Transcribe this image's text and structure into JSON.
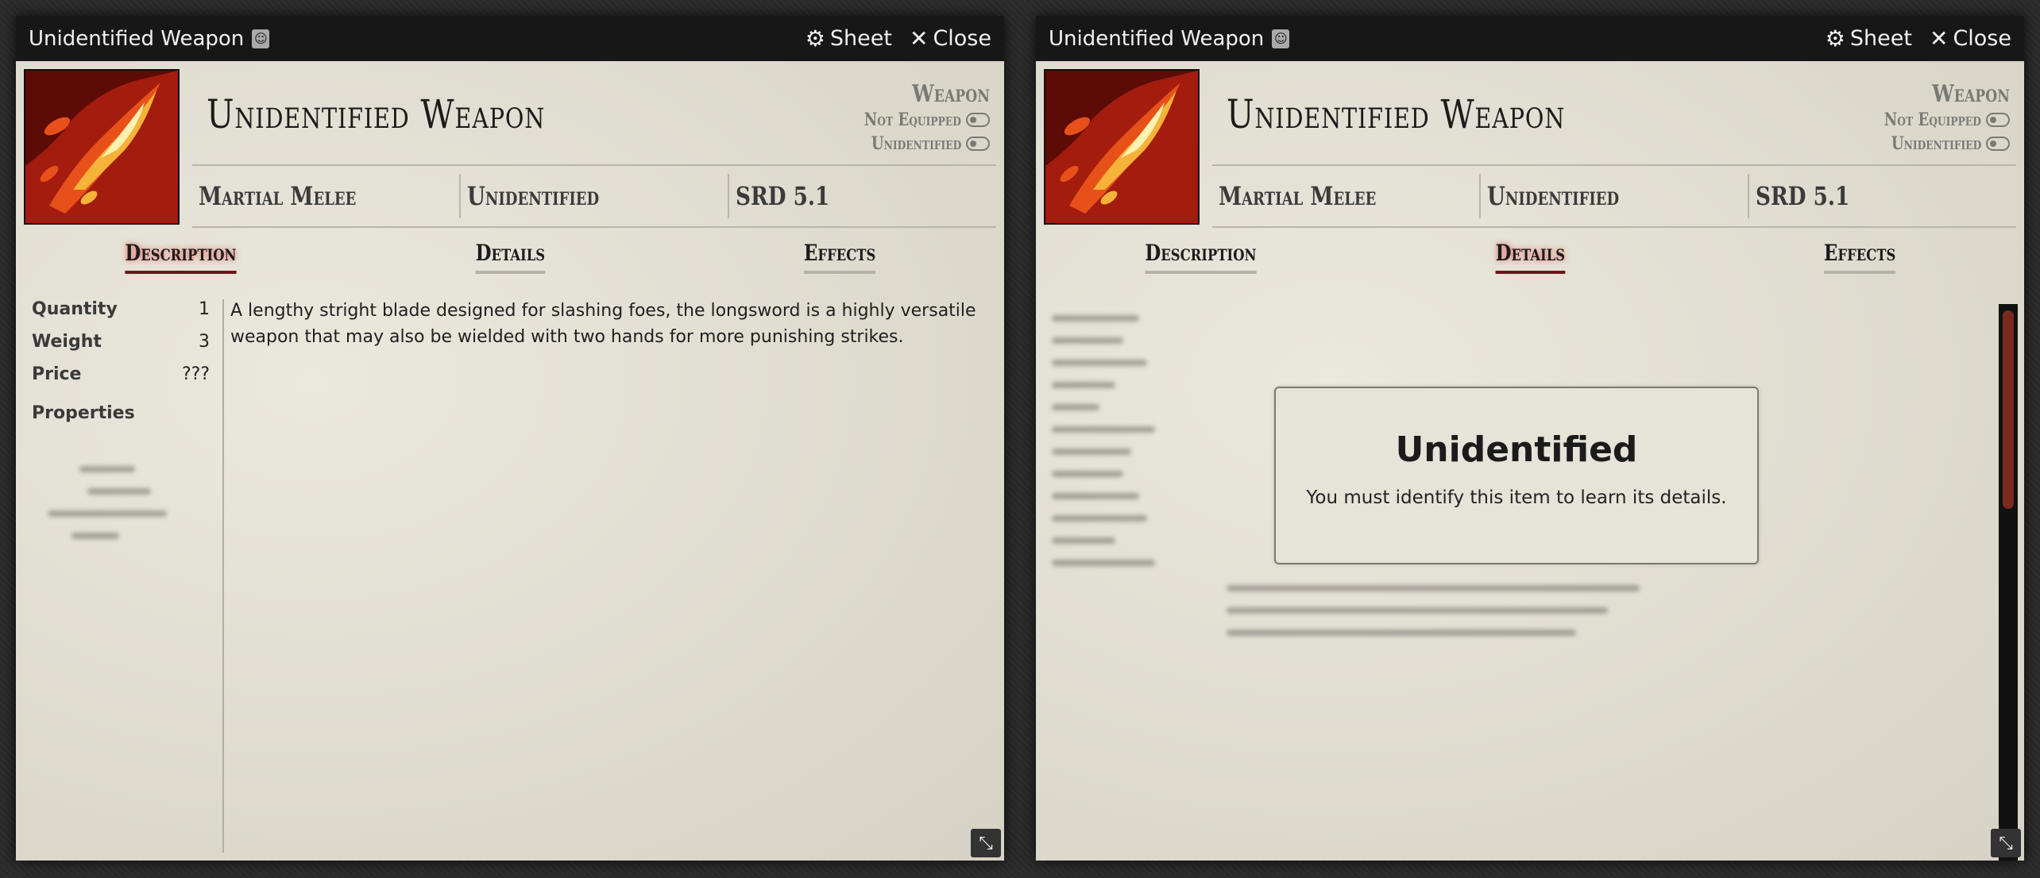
{
  "colors": {
    "accent": "#6e1515",
    "titlebar": "#171717",
    "parchment": "#e6e3d8"
  },
  "windows": [
    {
      "title": "Unidentified Weapon",
      "title_icon": "scroll-document-icon",
      "sheet_label": "Sheet",
      "close_label": "Close",
      "item_name": "Unidentified Weapon",
      "item_type": "Weapon",
      "equipped_label": "Not Equipped",
      "identified_label": "Unidentified",
      "summary": [
        "Martial Melee",
        "Unidentified",
        "SRD 5.1"
      ],
      "tabs": [
        "Description",
        "Details",
        "Effects"
      ],
      "active_tab": "Description",
      "properties": [
        {
          "label": "Quantity",
          "value": "1"
        },
        {
          "label": "Weight",
          "value": "3"
        },
        {
          "label": "Price",
          "value": "???"
        }
      ],
      "properties_heading": "Properties",
      "description": "A lengthy stright blade designed for slashing foes, the longsword is a highly versatile weapon that may also be wielded with two hands for more punishing strikes."
    },
    {
      "title": "Unidentified Weapon",
      "title_icon": "scroll-document-icon",
      "sheet_label": "Sheet",
      "close_label": "Close",
      "item_name": "Unidentified Weapon",
      "item_type": "Weapon",
      "equipped_label": "Not Equipped",
      "identified_label": "Unidentified",
      "summary": [
        "Martial Melee",
        "Unidentified",
        "SRD 5.1"
      ],
      "tabs": [
        "Description",
        "Details",
        "Effects"
      ],
      "active_tab": "Details",
      "locked_title": "Unidentified",
      "locked_message": "You must identify this item to learn its details."
    }
  ]
}
